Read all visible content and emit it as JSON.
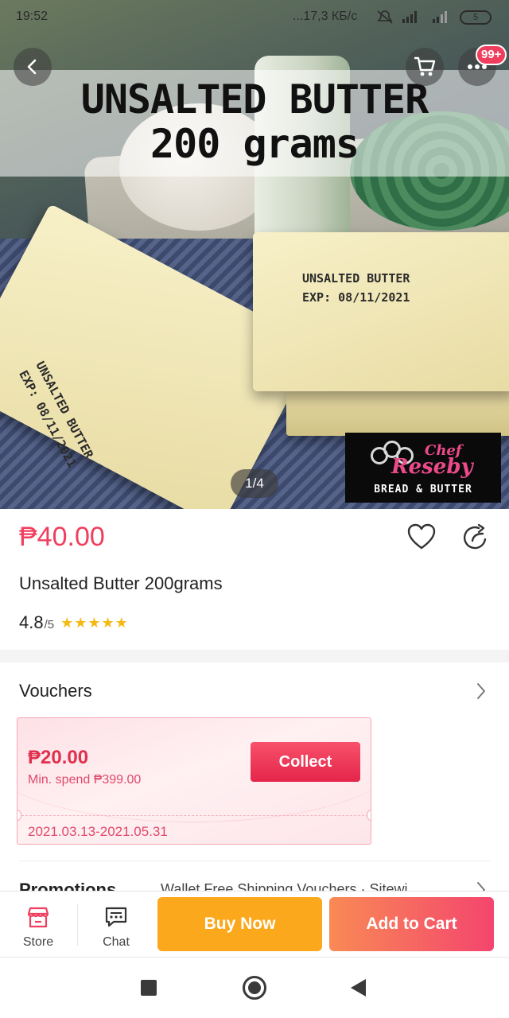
{
  "status_bar": {
    "time": "19:52",
    "network": "...17,3 КБ/с",
    "battery": "5"
  },
  "hero": {
    "title_line1": "UNSALTED BUTTER",
    "title_line2": "200 grams",
    "butter_label_line1": "UNSALTED BUTTER",
    "butter_label_line2": "EXP: 08/11/2021",
    "logo_chef": "Chef",
    "logo_name": "Reseby",
    "logo_tagline": "BREAD & BUTTER",
    "image_counter": "1/4"
  },
  "nav": {
    "notification_badge": "99+",
    "back_icon": "chevron-left-icon",
    "cart_icon": "cart-icon",
    "more_icon": "more-dots-icon"
  },
  "product": {
    "price": "₱40.00",
    "name": "Unsalted Butter 200grams",
    "rating_value": "4.8",
    "rating_max": "/5",
    "rating_stars": 4.8
  },
  "vouchers": {
    "title": "Vouchers",
    "card": {
      "amount": "₱20.00",
      "min_spend": "Min. spend ₱399.00",
      "collect_label": "Collect",
      "dates": "2021.03.13-2021.05.31"
    }
  },
  "promotions": {
    "label": "Promotions",
    "value": "Wallet Free Shipping Vouchers · Sitewi"
  },
  "action_bar": {
    "store_label": "Store",
    "chat_label": "Chat",
    "buy_now_label": "Buy Now",
    "add_to_cart_label": "Add to Cart"
  },
  "colors": {
    "accent": "#f03e5e",
    "buy_now": "#fba81c",
    "add_to_cart_start": "#f98a55",
    "add_to_cart_end": "#f4456e",
    "star": "#f5b914"
  }
}
